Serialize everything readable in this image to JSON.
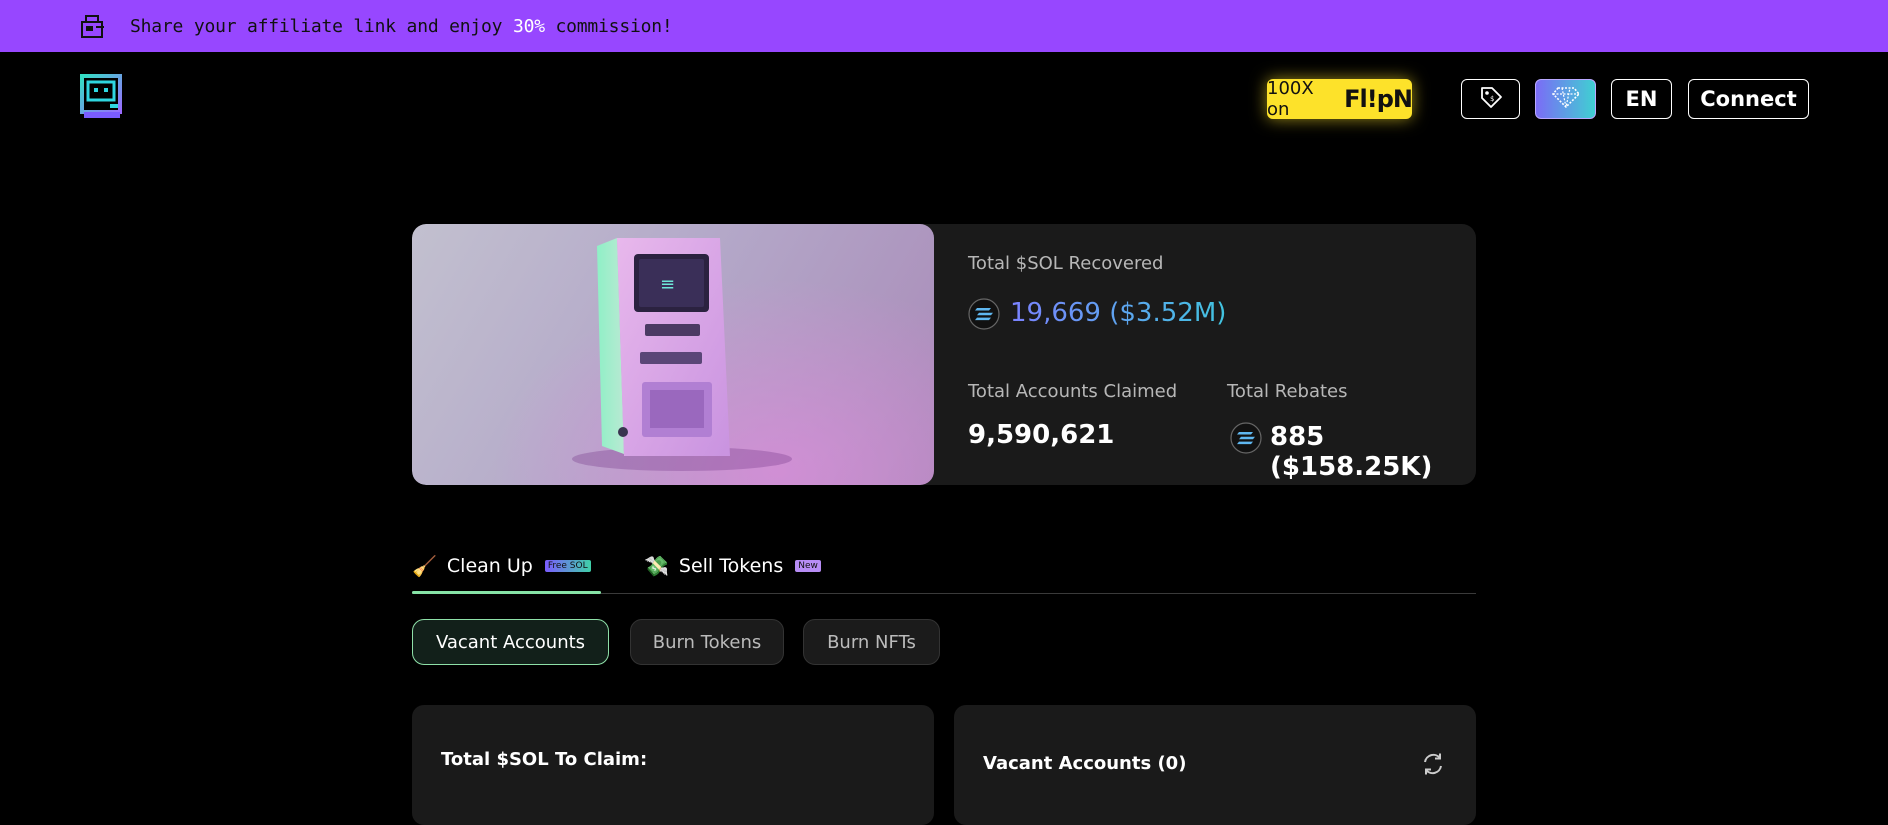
{
  "banner": {
    "text_before": "Share your affiliate link and enjoy ",
    "highlight": "30%",
    "text_after": " commission!",
    "icon": "share-box-icon"
  },
  "nav": {
    "flip_prefix": "100X on",
    "flip_logo": "Fl!pN",
    "tag_icon": "price-tag-icon",
    "diamond_icon": "diamond-icon",
    "language": "EN",
    "connect": "Connect"
  },
  "stats": {
    "recovered_label": "Total $SOL Recovered",
    "recovered_value": "19,669 ($3.52M)",
    "accounts_label": "Total Accounts Claimed",
    "accounts_value": "9,590,621",
    "rebates_label": "Total Rebates",
    "rebates_value": "885 ($158.25K)"
  },
  "tabs": [
    {
      "label": "Clean Up",
      "badge": "Free SOL",
      "icon": "broom-icon",
      "active": true
    },
    {
      "label": "Sell Tokens",
      "badge": "New",
      "icon": "money-icon",
      "active": false
    }
  ],
  "subtabs": [
    {
      "label": "Vacant Accounts",
      "active": true
    },
    {
      "label": "Burn Tokens",
      "active": false
    },
    {
      "label": "Burn NFTs",
      "active": false
    }
  ],
  "cards": {
    "claim_title": "Total $SOL To Claim:",
    "vacant_title": "Vacant Accounts (0)"
  },
  "colors": {
    "banner": "#9747ff",
    "accent_green": "#86e3a6",
    "flip_yellow": "#fde22a",
    "card_bg": "#1a1a1a"
  }
}
